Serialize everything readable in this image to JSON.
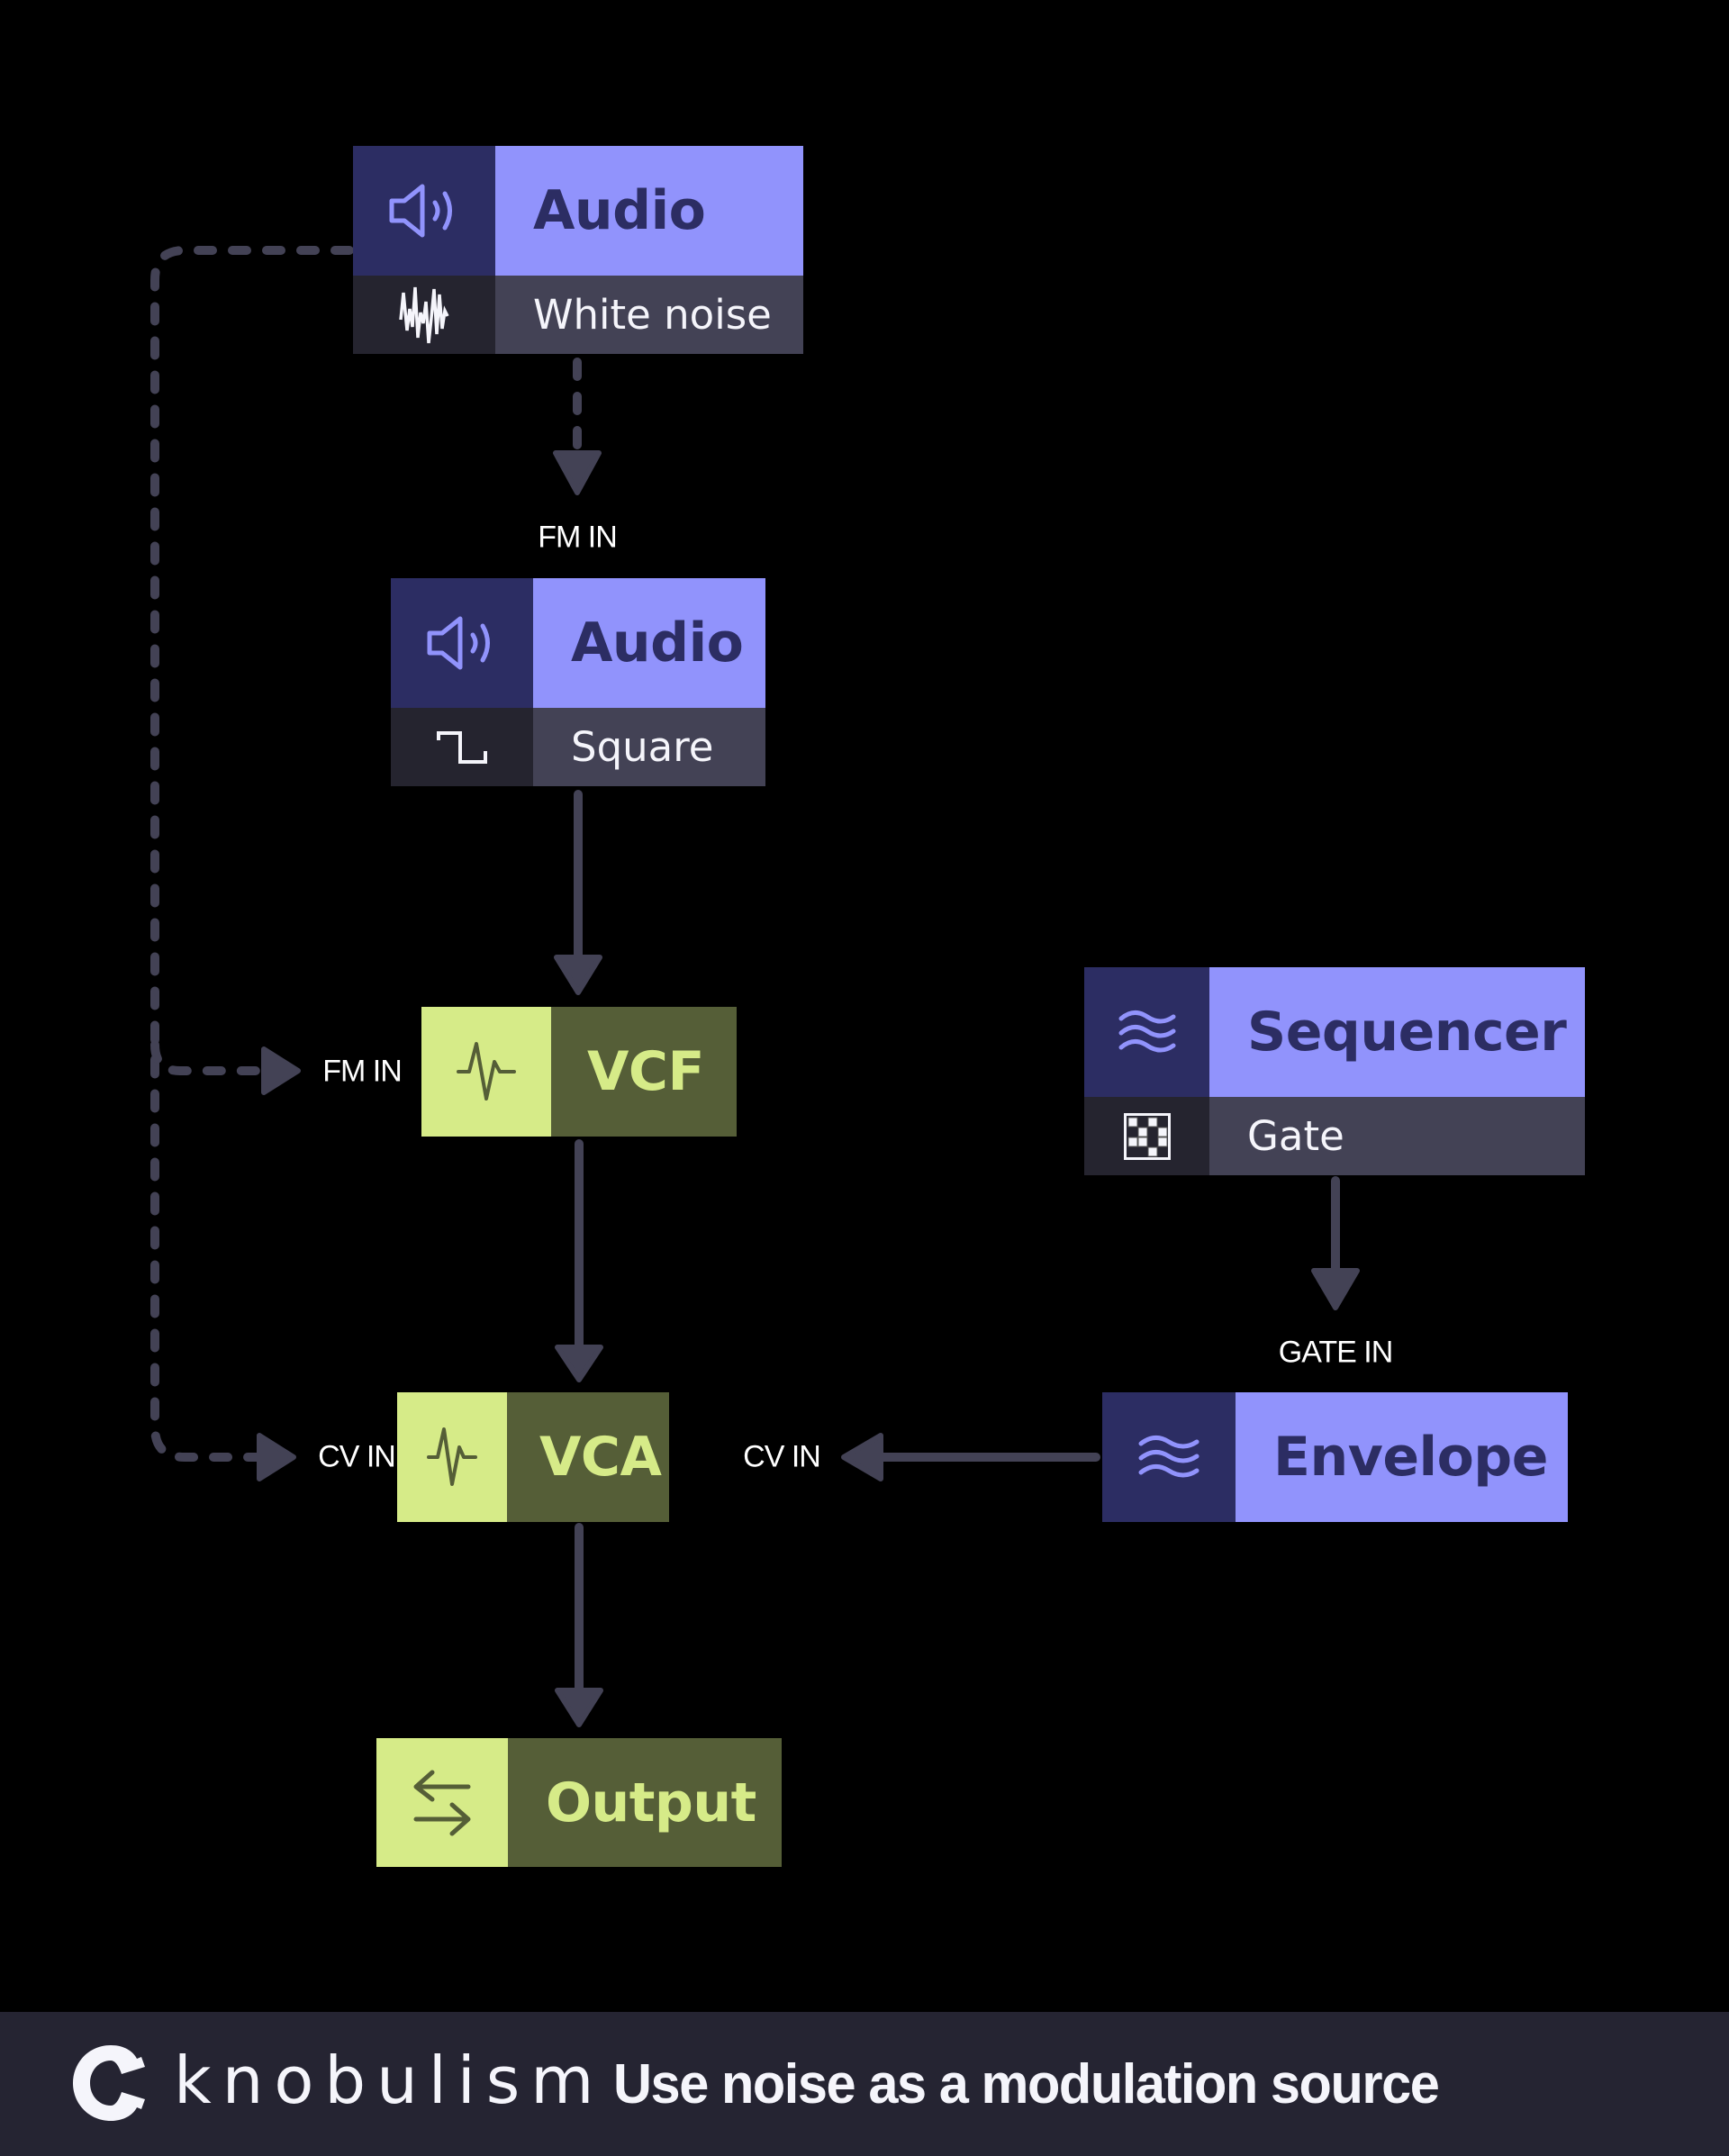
{
  "diagram": {
    "nodes": [
      {
        "id": "audio-noise",
        "type": "source",
        "title": "Audio",
        "subtitle": "White noise",
        "icon": "speaker-icon",
        "sub_icon": "noise-wave-icon"
      },
      {
        "id": "audio-square",
        "type": "source",
        "title": "Audio",
        "subtitle": "Square",
        "icon": "speaker-icon",
        "sub_icon": "square-wave-icon"
      },
      {
        "id": "vcf",
        "type": "processor",
        "title": "VCF",
        "icon": "pulse-icon"
      },
      {
        "id": "vca",
        "type": "processor",
        "title": "VCA",
        "icon": "pulse-icon"
      },
      {
        "id": "output",
        "type": "processor",
        "title": "Output",
        "icon": "swap-arrows-icon"
      },
      {
        "id": "sequencer",
        "type": "source",
        "title": "Sequencer",
        "subtitle": "Gate",
        "icon": "waves-icon",
        "sub_icon": "grid-pattern-icon"
      },
      {
        "id": "envelope",
        "type": "modulator",
        "title": "Envelope",
        "icon": "waves-icon"
      }
    ],
    "ports": {
      "square_fm_in": "FM IN",
      "vcf_fm_in": "FM IN",
      "vca_cv_in_left": "CV IN",
      "vca_cv_in_right": "CV IN",
      "envelope_gate_in": "GATE IN"
    },
    "connections": [
      {
        "from": "audio-noise",
        "to": "audio-square",
        "port": "FM IN",
        "style": "dashed"
      },
      {
        "from": "audio-noise",
        "to": "vcf",
        "port": "FM IN",
        "style": "dashed"
      },
      {
        "from": "audio-noise",
        "to": "vca",
        "port": "CV IN",
        "style": "dashed"
      },
      {
        "from": "audio-square",
        "to": "vcf",
        "style": "solid"
      },
      {
        "from": "vcf",
        "to": "vca",
        "style": "solid"
      },
      {
        "from": "vca",
        "to": "output",
        "style": "solid"
      },
      {
        "from": "sequencer",
        "to": "envelope",
        "port": "GATE IN",
        "style": "solid"
      },
      {
        "from": "envelope",
        "to": "vca",
        "port": "CV IN",
        "style": "solid"
      }
    ]
  },
  "colors": {
    "source_dark": "#2c2d63",
    "source_light": "#9193fc",
    "processor_light": "#d6eb88",
    "processor_dark": "#555e37",
    "wire": "#434255",
    "footer": "#252432"
  },
  "footer": {
    "brand": "knobulism",
    "headline": "Use noise as a modulation source"
  }
}
